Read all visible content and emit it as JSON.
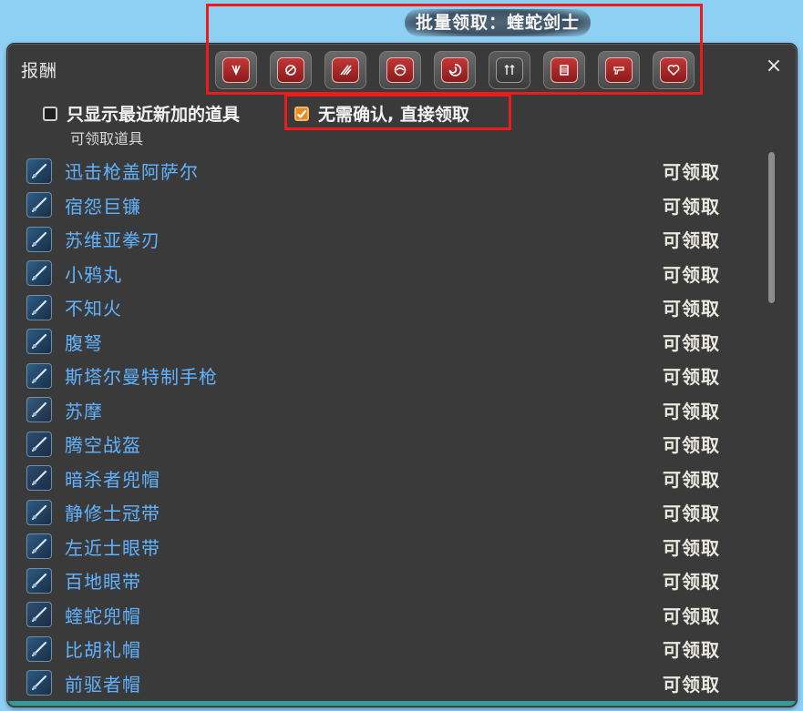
{
  "window": {
    "title": "报酬",
    "close_glyph": "×"
  },
  "batch_claim": {
    "title": "批量领取：蝰蛇剑士"
  },
  "job_icons": [
    {
      "icon": "paladin-job-icon"
    },
    {
      "icon": "scholar-job-icon"
    },
    {
      "icon": "claw-job-icon"
    },
    {
      "icon": "swirl-job-icon"
    },
    {
      "icon": "vortex-job-icon"
    },
    {
      "icon": "viper-job-icon",
      "selected": true
    },
    {
      "icon": "shield-job-icon"
    },
    {
      "icon": "gun-job-icon"
    },
    {
      "icon": "heart-job-icon"
    }
  ],
  "options": {
    "show_recent": {
      "label": "只显示最近新加的道具",
      "checked": false
    },
    "no_confirm": {
      "label": "无需确认, 直接领取",
      "checked": true
    }
  },
  "section_label": "可领取道具",
  "items": [
    {
      "name": "迅击枪盖阿萨尔",
      "status": "可领取",
      "icon": "lance-icon",
      "color": "#2b5d86"
    },
    {
      "name": "宿怨巨镰",
      "status": "可领取",
      "icon": "scythe-icon",
      "color": "#2d5e88"
    },
    {
      "name": "苏维亚拳刃",
      "status": "可领取",
      "icon": "fist-blade-icon",
      "color": "#2a5b83"
    },
    {
      "name": "小鸦丸",
      "status": "可领取",
      "icon": "katana-icon",
      "color": "#2c5f8a"
    },
    {
      "name": "不知火",
      "status": "可领取",
      "icon": "dagger-icon",
      "color": "#2b5c86"
    },
    {
      "name": "腹弩",
      "status": "可领取",
      "icon": "crossbow-icon",
      "color": "#2a5a84"
    },
    {
      "name": "斯塔尔曼特制手枪",
      "status": "可领取",
      "icon": "pistol-blade-icon",
      "color": "#2c5e87"
    },
    {
      "name": "苏摩",
      "status": "可领取",
      "icon": "chakram-icon",
      "color": "#3a5a7a"
    },
    {
      "name": "腾空战盔",
      "status": "可领取",
      "icon": "helmet-icon",
      "color": "#2a4d72"
    },
    {
      "name": "暗杀者兜帽",
      "status": "可领取",
      "icon": "hood-icon",
      "color": "#2b4a6c"
    },
    {
      "name": "静修士冠带",
      "status": "可领取",
      "icon": "headband-icon",
      "color": "#2c5b85"
    },
    {
      "name": "左近士眼带",
      "status": "可领取",
      "icon": "eyeband-icon",
      "color": "#2c5c86"
    },
    {
      "name": "百地眼带",
      "status": "可领取",
      "icon": "blindfold-icon",
      "color": "#2b5a83"
    },
    {
      "name": "蝰蛇兜帽",
      "status": "可领取",
      "icon": "viper-hood-icon",
      "color": "#2d4f72"
    },
    {
      "name": "比胡礼帽",
      "status": "可领取",
      "icon": "hat-icon",
      "color": "#2b5a84"
    },
    {
      "name": "前驱者帽",
      "status": "可领取",
      "icon": "cap-icon",
      "color": "#2b5a84"
    }
  ],
  "colors": {
    "accent_red": "#ee1b1b",
    "link_blue": "#61b3ff",
    "checkbox_orange": "#e88b1a"
  }
}
